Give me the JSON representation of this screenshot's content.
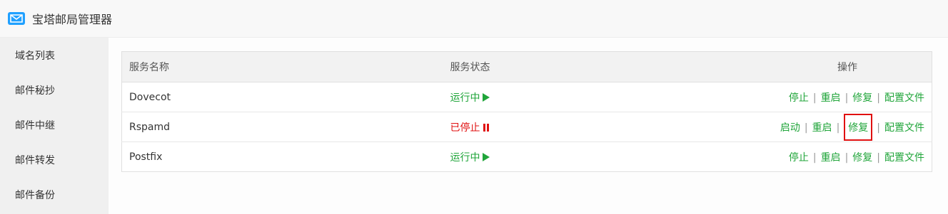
{
  "window": {
    "title": "宝塔邮局管理器"
  },
  "sidebar": {
    "items": [
      {
        "label": "域名列表"
      },
      {
        "label": "邮件秘抄"
      },
      {
        "label": "邮件中继"
      },
      {
        "label": "邮件转发"
      },
      {
        "label": "邮件备份"
      }
    ]
  },
  "table": {
    "headers": {
      "name": "服务名称",
      "status": "服务状态",
      "ops": "操作"
    },
    "rows": [
      {
        "name": "Dovecot",
        "status": "运行中",
        "state": "running",
        "actions": [
          "停止",
          "重启",
          "修复",
          "配置文件"
        ]
      },
      {
        "name": "Rspamd",
        "status": "已停止",
        "state": "stopped",
        "actions": [
          "启动",
          "重启",
          "修复",
          "配置文件"
        ]
      },
      {
        "name": "Postfix",
        "status": "运行中",
        "state": "running",
        "actions": [
          "停止",
          "重启",
          "修复",
          "配置文件"
        ]
      }
    ]
  },
  "colors": {
    "accent": "#20a53a",
    "danger": "#e01010",
    "highlight": "#e01010"
  }
}
